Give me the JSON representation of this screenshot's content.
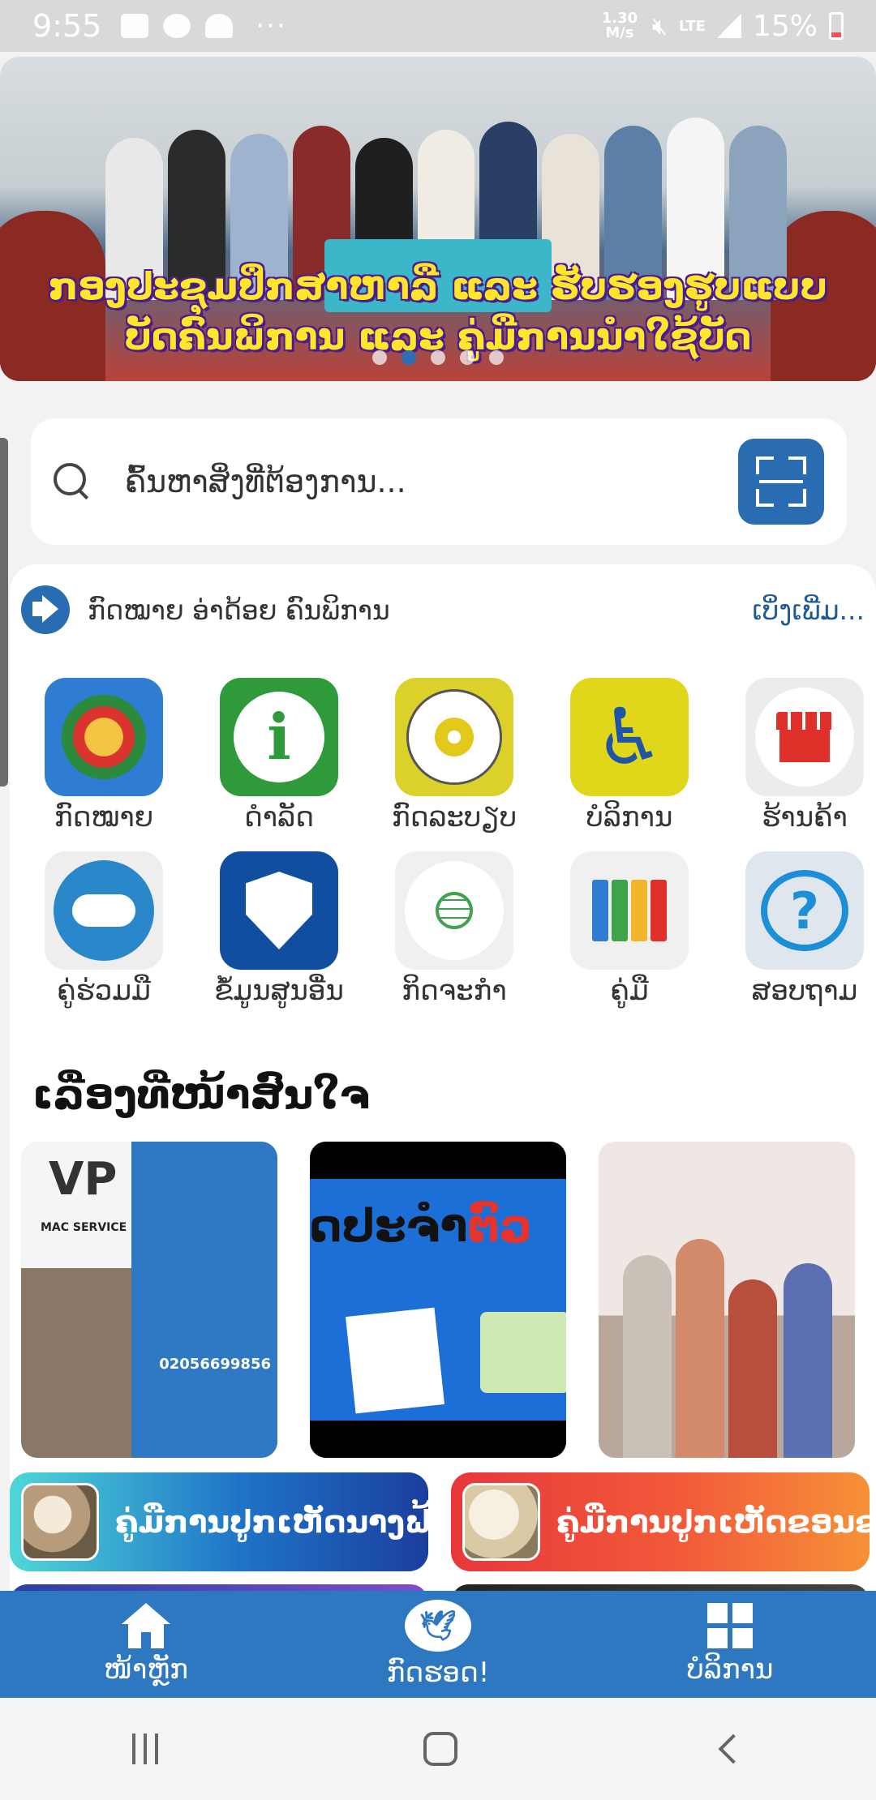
{
  "status_bar": {
    "time": "9:55",
    "network_speed": "1.30 M/s",
    "network_type": "LTE",
    "battery": "15%"
  },
  "hero": {
    "caption_line1": "ກອງປະຊຸມປຶກສາຫາລື ແລະ ຮັບຮອງຮູບແບບ",
    "caption_line2": "ບັດຄົນພິການ ແລະ ຄູ່ມືການນຳໃຊ້ບັດ",
    "slides_total": 5,
    "active_slide": 2
  },
  "search": {
    "placeholder": "ຄົ້ນຫາສິ່ງທີ່ຕ້ອງການ..."
  },
  "announcement": {
    "text": "ກົດໝາຍ ອ່າດ້ອຍ ຄົນພິການ",
    "more": "ເບິ່ງເພີ່ມ..."
  },
  "menu": [
    {
      "label": "ກົດໝາຍ",
      "icon": "emblem-icon"
    },
    {
      "label": "ດຳລັດ",
      "icon": "info-icon"
    },
    {
      "label": "ກົດລະບຽບ",
      "icon": "association-seal-icon"
    },
    {
      "label": "ບໍລິການ",
      "icon": "wheelchair-icon"
    },
    {
      "label": "ຮ້ານຄ້າ",
      "icon": "shop-icon"
    },
    {
      "label": "ຄູ່ຮ່ວມມື",
      "icon": "handshake-icon"
    },
    {
      "label": "ຂໍ້ມູນສູນອື່ນ",
      "icon": "accessibility-shield-icon"
    },
    {
      "label": "ກິດຈະກຳ",
      "icon": "globe-people-icon"
    },
    {
      "label": "ຄູ່ມື",
      "icon": "binders-icon"
    },
    {
      "label": "ສອບຖາມ",
      "icon": "question-bubble-icon"
    }
  ],
  "stories": {
    "title": "ເລື່ອງທີ່ໜ້າສົນໃຈ",
    "story1": {
      "logo": "VP",
      "brand": "MAC SERVICE",
      "phone": "02056699856"
    },
    "story2": {
      "headline_black": "ດປະຈຳ",
      "headline_red": "ຕົວ"
    }
  },
  "guides": [
    {
      "title": "ຄູ່ມືການປູກເຫັດນາງຟ້າ"
    },
    {
      "title": "ຄູ່ມືການປູກເຫັດຂອນຂາວ"
    }
  ],
  "bottom_nav": {
    "home": "ໜ້າຫຼັກ",
    "chat": "ກົດຮອດ!",
    "services": "ບໍລິການ"
  },
  "colors": {
    "primary": "#2d78c0",
    "search_button": "#2a6cb2",
    "hero_caption": "#ffe62a"
  }
}
